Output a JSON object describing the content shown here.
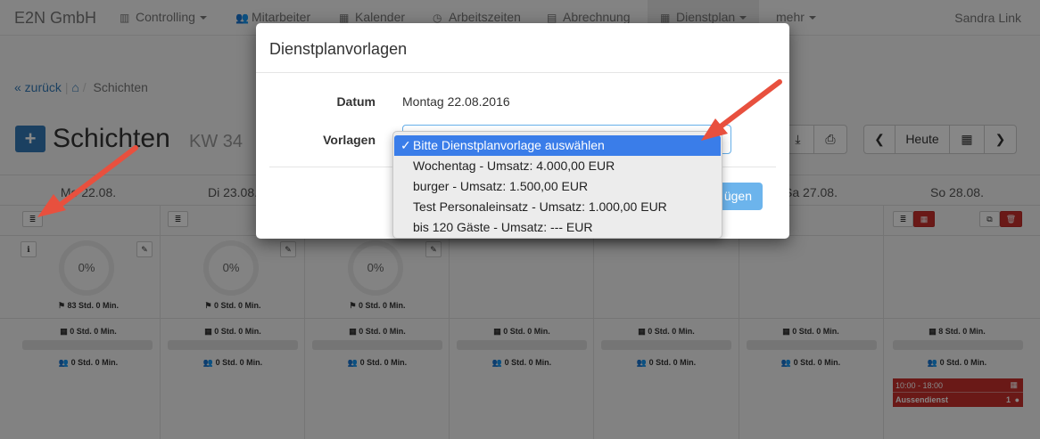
{
  "navbar": {
    "brand": "E2N GmbH",
    "items": [
      {
        "label": "Controlling",
        "icon": "bar-chart-icon"
      },
      {
        "label": "Mitarbeiter",
        "icon": "users-icon"
      },
      {
        "label": "Kalender",
        "icon": "calendar-icon"
      },
      {
        "label": "Arbeitszeiten",
        "icon": "clock-icon"
      },
      {
        "label": "Abrechnung",
        "icon": "calculator-icon"
      },
      {
        "label": "Dienstplan",
        "icon": "calendar-check-icon"
      },
      {
        "label": "mehr",
        "icon": ""
      }
    ],
    "user": "Sandra Link"
  },
  "breadcrumb": {
    "back": "« zurück",
    "current": "Schichten"
  },
  "page": {
    "title": "Schichten",
    "week": "KW 34",
    "today_label": "Heute"
  },
  "days": [
    {
      "label": "Mo 22.08.",
      "percent": "0%",
      "planned": "83 Std. 0 Min.",
      "hours": "0 Std. 0 Min.",
      "staff": "0 Std. 0 Min."
    },
    {
      "label": "Di 23.08.",
      "percent": "0%",
      "planned": "0 Std. 0 Min.",
      "hours": "0 Std. 0 Min.",
      "staff": "0 Std. 0 Min."
    },
    {
      "label": "",
      "percent": "0%",
      "planned": "0 Std. 0 Min.",
      "hours": "0 Std. 0 Min.",
      "staff": "0 Std. 0 Min."
    },
    {
      "label": "",
      "hours": "0 Std. 0 Min.",
      "staff": "0 Std. 0 Min."
    },
    {
      "label": "",
      "hours": "0 Std. 0 Min.",
      "staff": "0 Std. 0 Min."
    },
    {
      "label": "Sa 27.08.",
      "hours": "0 Std. 0 Min.",
      "staff": "0 Std. 0 Min."
    },
    {
      "label": "So 28.08.",
      "hours": "8 Std. 0 Min.",
      "staff": "0 Std. 0 Min."
    }
  ],
  "shift": {
    "time": "10:00 - 18:00",
    "name": "Aussendienst",
    "count": "1"
  },
  "modal": {
    "title": "Dienstplanvorlagen",
    "datum_label": "Datum",
    "datum_value": "Montag 22.08.2016",
    "vorlagen_label": "Vorlagen",
    "add_button": "ügen"
  },
  "dropdown": {
    "options": [
      "Bitte Dienstplanvorlage auswählen",
      "Wochentag - Umsatz: 4.000,00 EUR",
      "burger - Umsatz: 1.500,00 EUR",
      "Test Personaleinsatz - Umsatz: 1.000,00 EUR",
      "bis 120 Gäste - Umsatz: --- EUR"
    ],
    "selected_index": 0
  },
  "colors": {
    "primary": "#337ab7",
    "danger": "#c9302c",
    "highlight": "#3a7de9",
    "arrow": "#e8503e"
  }
}
